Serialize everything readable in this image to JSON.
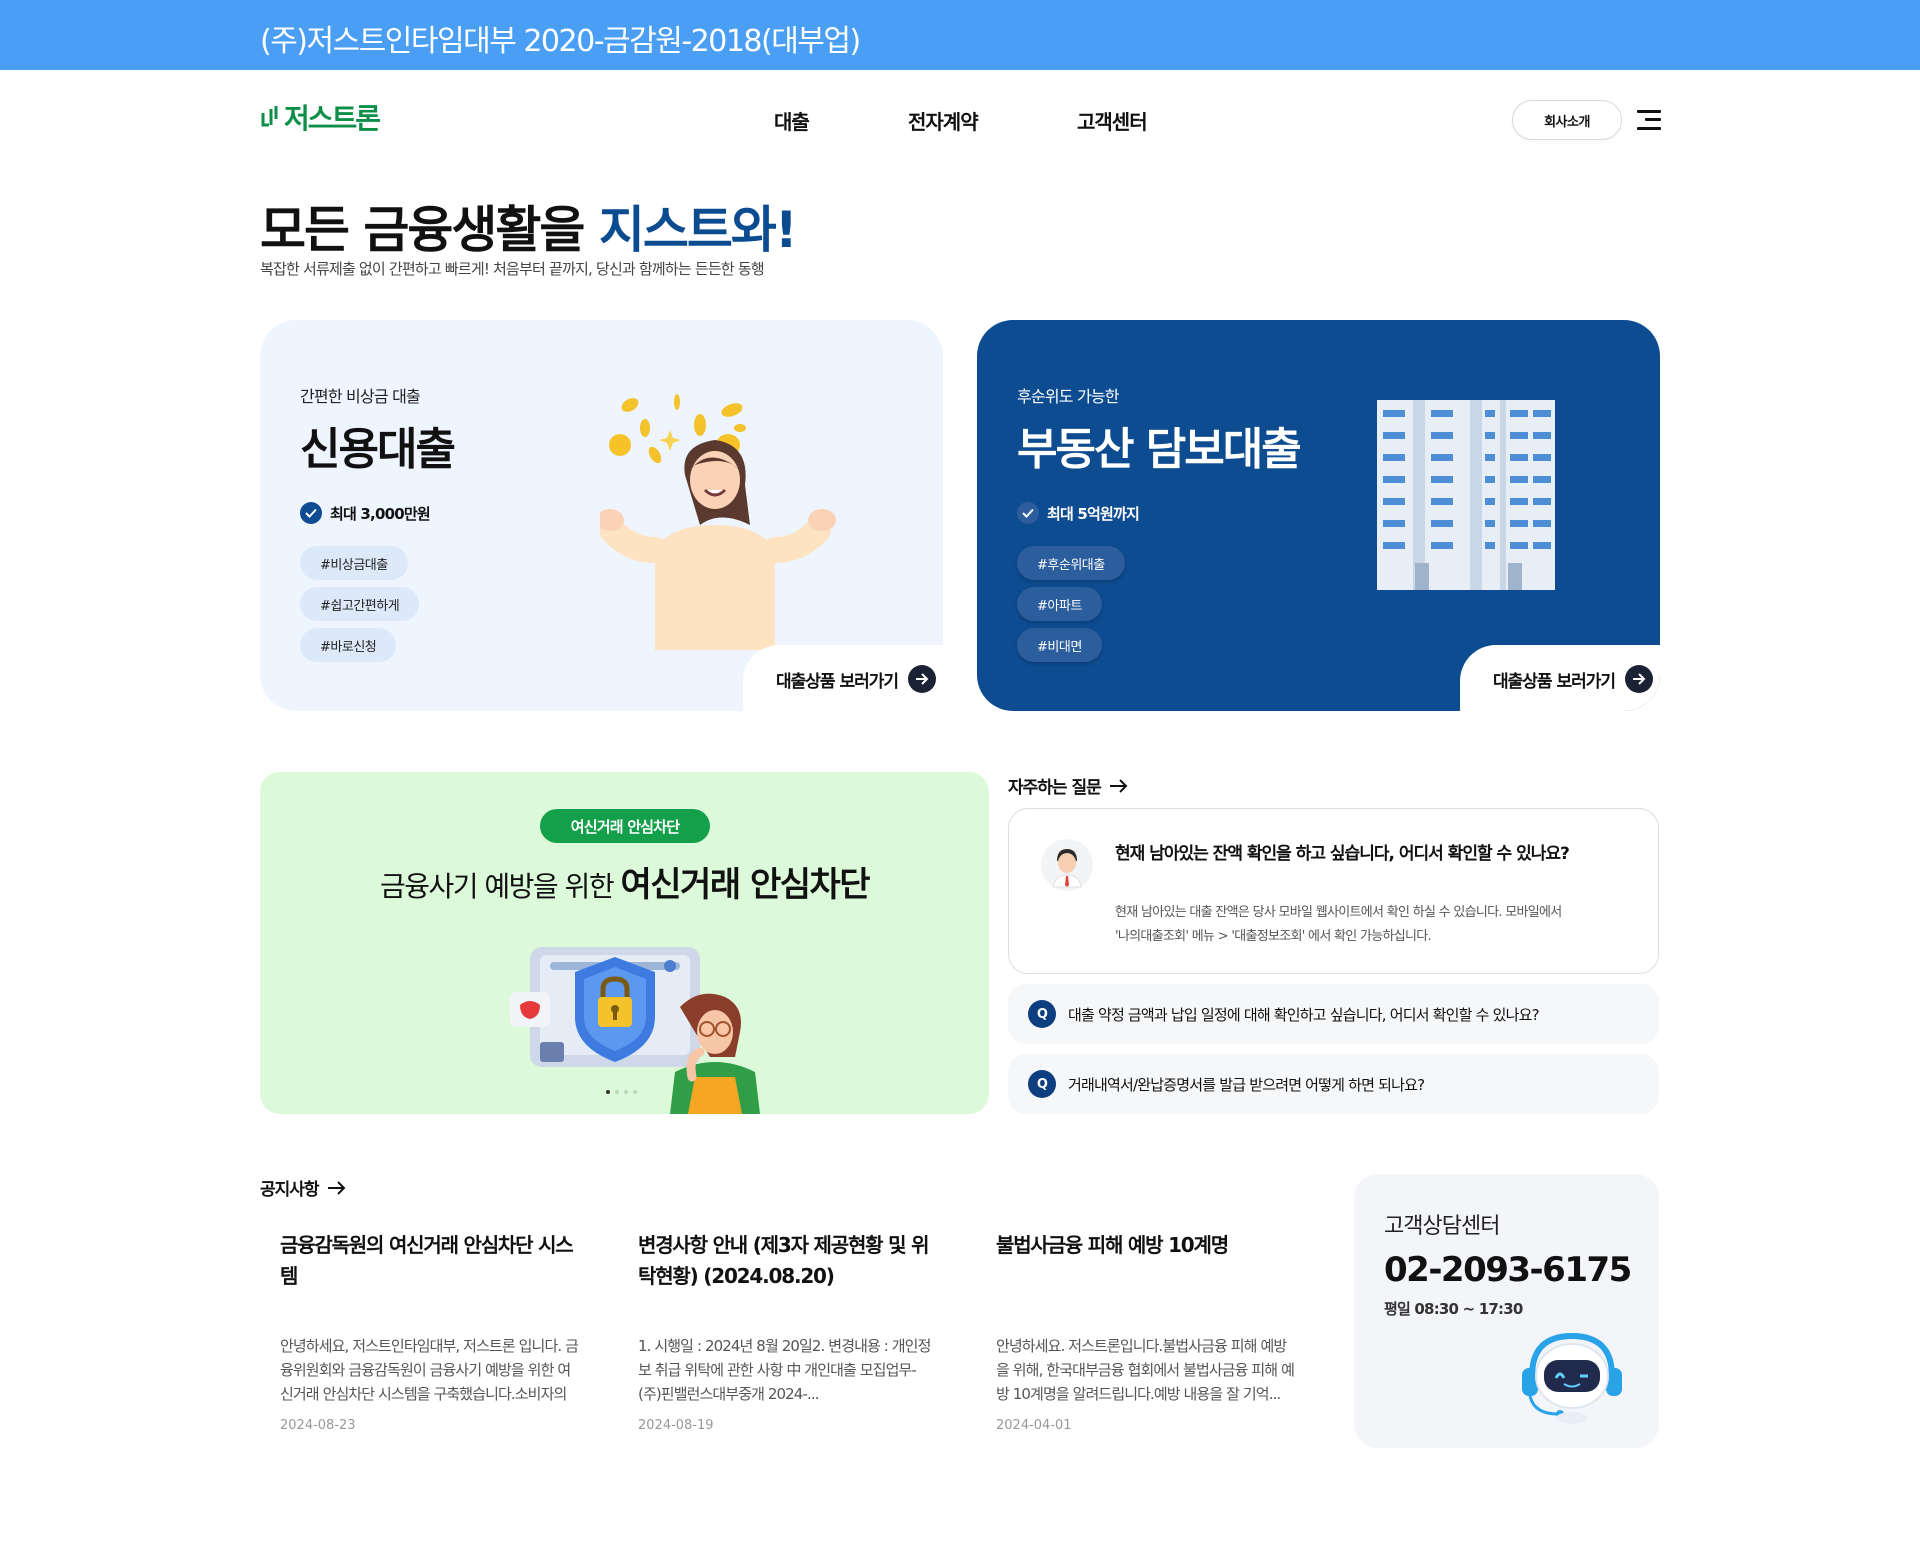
{
  "topbar": {
    "text": "(주)저스트인타임대부 2020-금감원-2018(대부업)"
  },
  "header": {
    "logo": "저스트론",
    "nav": [
      "대출",
      "전자계약",
      "고객센터"
    ],
    "about_label": "회사소개"
  },
  "hero": {
    "title_prefix": "모든 금융생활을 ",
    "title_highlight": "지스트와!",
    "subtitle": "복잡한 서류제출 없이 간편하고 빠르게! 처음부터 끝까지, 당신과 함께하는 든든한 동행"
  },
  "cards": [
    {
      "small": "간편한 비상금 대출",
      "big": "신용대출",
      "check": "최대 3,000만원",
      "tags": [
        "#비상금대출",
        "#쉽고간편하게",
        "#바로신청"
      ],
      "link": "대출상품 보러가기"
    },
    {
      "small": "후순위도 가능한",
      "big": "부동산 담보대출",
      "check": "최대 5억원까지",
      "tags": [
        "#후순위대출",
        "#아파트",
        "#비대면"
      ],
      "link": "대출상품 보러가기"
    }
  ],
  "banner": {
    "pill": "여신거래 안심차단",
    "title_light": "금융사기 예방을 위한 ",
    "title_bold": "여신거래 안심차단"
  },
  "faq": {
    "heading": "자주하는 질문",
    "open": {
      "question": "현재 남아있는 잔액 확인을 하고 싶습니다, 어디서 확인할 수 있나요?",
      "answer_line1": "현재 남아있는 대출 잔액은 당사 모바일 웹사이트에서 확인 하실 수 있습니다. 모바일에서",
      "answer_line2": "'나의대출조회' 메뉴 > '대출정보조회' 에서 확인 가능하십니다."
    },
    "q_label": "Q",
    "items": [
      "대출 약정 금액과 납입 일정에 대해 확인하고 싶습니다, 어디서 확인할 수 있나요?",
      "거래내역서/완납증명서를 발급 받으려면 어떻게 하면 되나요?"
    ]
  },
  "notices": {
    "heading": "공지사항",
    "items": [
      {
        "title": "금융감독원의 여신거래 안심차단 시스템",
        "body": "안녕하세요, 저스트인타임대부, 저스트론 입니다. 금융위원회와 금융감독원이 금융사기 예방을 위한 여신거래 안심차단 시스템을 구축했습니다.소비자의 선...",
        "date": "2024-08-23"
      },
      {
        "title": "변경사항 안내 (제3자 제공현황 및 위탁현황) (2024.08.20)",
        "body": "1. 시행일 : 2024년 8월 20일2. 변경내용 : 개인정보 취급 위탁에 관한 사항 中 개인대출 모집업무-(주)핀밸런스대부중개 2024-...",
        "date": "2024-08-19"
      },
      {
        "title": "불법사금융 피해 예방 10계명",
        "body": "안녕하세요. 저스트론입니다.불법사금융 피해 예방을 위해, 한국대부금융 협회에서 불법사금융 피해 예방 10계명을 알려드립니다.예방 내용을 잘 기억...",
        "date": "2024-04-01"
      }
    ]
  },
  "cs": {
    "title": "고객상담센터",
    "phone": "02-2093-6175",
    "hours": "평일 08:30 ~ 17:30"
  },
  "colors": {
    "topbar": "#4a9ff5",
    "brand_green": "#0d8f4a",
    "navy": "#0e4c92",
    "credit_card_bg": "#eef5ff",
    "banner_bg": "#dcfad9"
  },
  "icons": [
    "menu-icon",
    "check-icon",
    "arrow-right-icon",
    "q-icon",
    "lock-shield-icon",
    "robot-icon"
  ]
}
